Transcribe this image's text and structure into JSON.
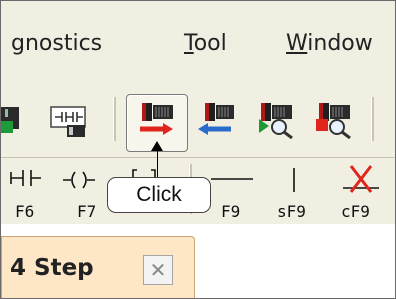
{
  "menubar": {
    "items": [
      {
        "label": "gnostics"
      },
      {
        "label": "Tool",
        "accel": "T",
        "rest": "ool"
      },
      {
        "label": "Window",
        "accel": "W",
        "rest": "indow"
      }
    ]
  },
  "toolbar2": {
    "keys": [
      "F6",
      "F7",
      "F9",
      "sF9",
      "cF9"
    ]
  },
  "callout": {
    "text": "Click"
  },
  "tab": {
    "title": "4 Step",
    "close_glyph": "✕"
  }
}
